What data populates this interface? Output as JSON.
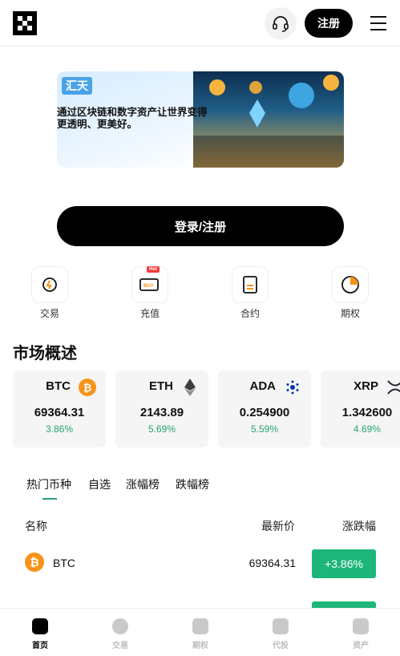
{
  "header": {
    "logo": "logo-icon",
    "support_icon": "headset-icon",
    "register_label": "注册",
    "menu_icon": "menu-icon"
  },
  "banner": {
    "brand": "汇天",
    "text": "通过区块链和数字资产让世界变得更透明、更美好。"
  },
  "login_label": "登录/注册",
  "quick_nav": [
    {
      "label": "交易",
      "icon": "trade-icon"
    },
    {
      "label": "充值",
      "icon": "deposit-icon",
      "badge": "Hot"
    },
    {
      "label": "合约",
      "icon": "contract-icon"
    },
    {
      "label": "期权",
      "icon": "options-icon"
    }
  ],
  "market": {
    "title": "市场概述",
    "cards": [
      {
        "symbol": "BTC",
        "price": "69364.31",
        "change": "3.86%",
        "icon": "bitcoin-icon",
        "color": "#f7931a"
      },
      {
        "symbol": "ETH",
        "price": "2143.89",
        "change": "5.69%",
        "icon": "ethereum-icon",
        "color": "#3c3c3d"
      },
      {
        "symbol": "ADA",
        "price": "0.254900",
        "change": "5.59%",
        "icon": "cardano-icon",
        "color": "#0033ad"
      },
      {
        "symbol": "XRP",
        "price": "1.342600",
        "change": "4.69%",
        "icon": "xrp-icon",
        "color": "#23292f"
      }
    ]
  },
  "tabs": [
    "热门币种",
    "自选",
    "涨幅榜",
    "跌幅榜"
  ],
  "table": {
    "headers": {
      "name": "名称",
      "price": "最新价",
      "change": "涨跌幅"
    },
    "rows": [
      {
        "symbol": "BTC",
        "price": "69364.31",
        "change": "+3.86%",
        "icon": "bitcoin-icon"
      }
    ]
  },
  "bottom_nav": [
    {
      "label": "首页",
      "icon": "home-icon",
      "active": true
    },
    {
      "label": "交易",
      "icon": "trade-icon"
    },
    {
      "label": "期权",
      "icon": "options-icon"
    },
    {
      "label": "代投",
      "icon": "copy-trade-icon"
    },
    {
      "label": "资产",
      "icon": "wallet-icon"
    }
  ],
  "colors": {
    "accent": "#25a76a",
    "up": "#1db67a",
    "primary": "#000000"
  }
}
